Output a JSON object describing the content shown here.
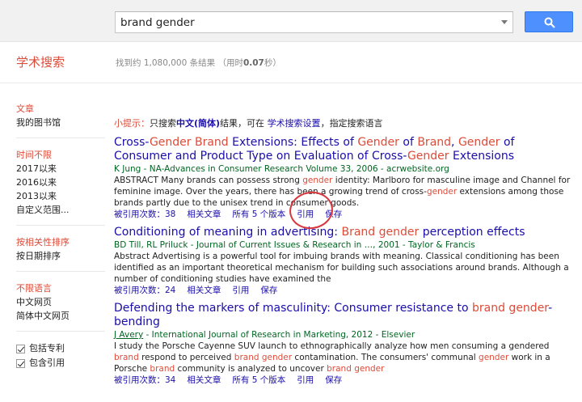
{
  "search": {
    "query": "brand gender"
  },
  "logo": "学术搜索",
  "stats": {
    "prefix": "找到约 1,080,000 条结果 （用时",
    "time": "0.07",
    "suffix": "秒）"
  },
  "sidebar": {
    "group1": [
      "文章",
      "我的图书馆"
    ],
    "group2": [
      "时间不限",
      "2017以来",
      "2016以来",
      "2013以来",
      "自定义范围..."
    ],
    "group3": [
      "按相关性排序",
      "按日期排序"
    ],
    "group4": [
      "不限语言",
      "中文网页",
      "简体中文网页"
    ],
    "checkboxes": [
      "包括专利",
      "包含引用"
    ]
  },
  "tip": {
    "label": "小提示：",
    "text1": "只搜索",
    "bold": "中文(简体)",
    "text2": "结果，可在",
    "link": "学术搜索设置",
    "text3": "指定搜索语言"
  },
  "results": [
    {
      "title": [
        {
          "t": "Cross-",
          "h": false
        },
        {
          "t": "Gender Brand",
          "h": true
        },
        {
          "t": " Extensions: Effects of ",
          "h": false
        },
        {
          "t": "Gender",
          "h": true
        },
        {
          "t": " of ",
          "h": false
        },
        {
          "t": "Brand",
          "h": true
        },
        {
          "t": ", ",
          "h": false
        },
        {
          "t": "Gender",
          "h": true
        },
        {
          "t": " of Consumer and Product Type on Evaluation of Cross-",
          "h": false
        },
        {
          "t": "Gender",
          "h": true
        },
        {
          "t": " Extensions",
          "h": false
        }
      ],
      "meta": "K Jung - NA-Advances in Consumer Research Volume 33, 2006 - acrwebsite.org",
      "snippet": [
        {
          "t": "ABSTRACT Many brands can possess strong ",
          "h": false
        },
        {
          "t": "gender",
          "h": true
        },
        {
          "t": " identity: Marlboro for masculine image and Channel for feminine image. Over the years, there has been a growing trend of cross-",
          "h": false
        },
        {
          "t": "gender",
          "h": true
        },
        {
          "t": " extensions among those brands partly due to the unisex trend in consumer goods.",
          "h": false
        }
      ],
      "links": [
        "被引用次数：38",
        "相关文章",
        "所有 5 个版本",
        "引用",
        "保存"
      ]
    },
    {
      "title": [
        {
          "t": "Conditioning of meaning in advertising: ",
          "h": false
        },
        {
          "t": "Brand gender",
          "h": true
        },
        {
          "t": " perception effects",
          "h": false
        }
      ],
      "meta": "BD Till, RL Priluck - Journal of Current Issues & Research in …, 2001 - Taylor & Francis",
      "snippet": [
        {
          "t": "Abstract Advertising is a powerful tool for imbuing brands with meaning. Classical conditioning has been identified as an important theoretical mechanism for building such associations around brands. Although a number of conditioning studies have examined the",
          "h": false
        }
      ],
      "links": [
        "被引用次数：24",
        "相关文章",
        "引用",
        "保存"
      ]
    },
    {
      "title": [
        {
          "t": "Defending the markers of masculinity: Consumer resistance to ",
          "h": false
        },
        {
          "t": "brand gender",
          "h": true
        },
        {
          "t": "-bending",
          "h": false
        }
      ],
      "meta_author": "J Avery",
      "meta": " - International Journal of Research in Marketing, 2012 - Elsevier",
      "snippet": [
        {
          "t": "I study the Porsche Cayenne SUV launch to ethnographically analyze how men consuming a gendered ",
          "h": false
        },
        {
          "t": "brand",
          "h": true
        },
        {
          "t": " respond to perceived ",
          "h": false
        },
        {
          "t": "brand gender",
          "h": true
        },
        {
          "t": " contamination. The consumers' communal ",
          "h": false
        },
        {
          "t": "gender",
          "h": true
        },
        {
          "t": " work in a Porsche ",
          "h": false
        },
        {
          "t": "brand",
          "h": true
        },
        {
          "t": " community is analyzed to uncover ",
          "h": false
        },
        {
          "t": "brand gender",
          "h": true
        }
      ],
      "links": [
        "被引用次数：34",
        "相关文章",
        "所有 5 个版本",
        "引用",
        "保存"
      ]
    }
  ]
}
